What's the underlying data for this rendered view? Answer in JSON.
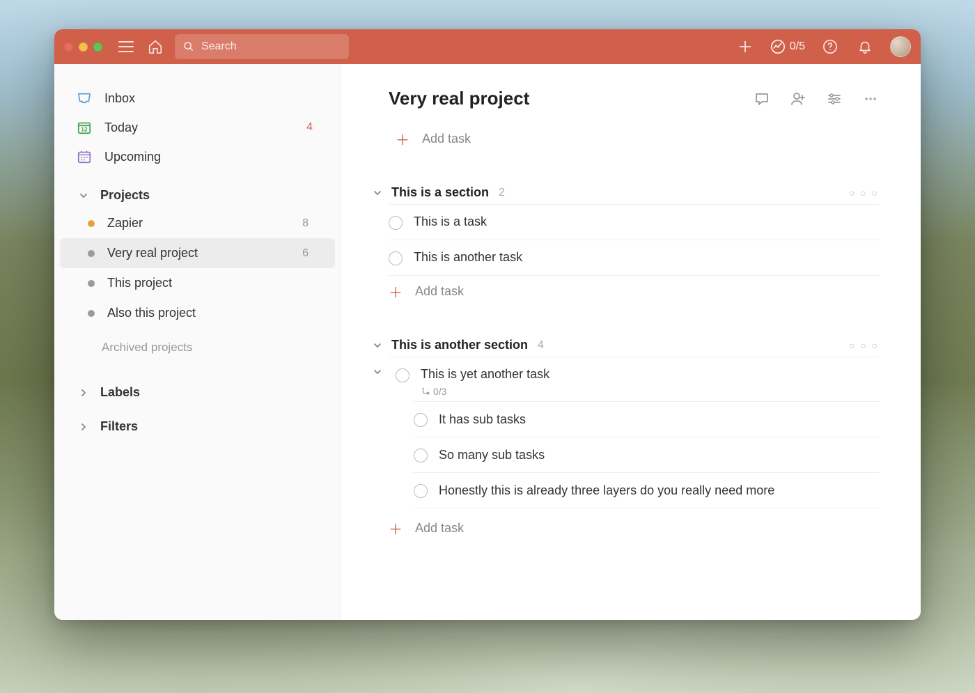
{
  "titlebar": {
    "search_placeholder": "Search",
    "progress_count": "0/5"
  },
  "sidebar": {
    "inbox": "Inbox",
    "today": "Today",
    "today_count": "4",
    "upcoming": "Upcoming",
    "projects_header": "Projects",
    "projects": [
      {
        "name": "Zapier",
        "count": "8",
        "color": "#e8a33d",
        "active": false
      },
      {
        "name": "Very real project",
        "count": "6",
        "color": "#9b9b9b",
        "active": true
      },
      {
        "name": "This project",
        "count": "",
        "color": "#9b9b9b",
        "active": false
      },
      {
        "name": "Also this project",
        "count": "",
        "color": "#9b9b9b",
        "active": false
      }
    ],
    "archived": "Archived projects",
    "labels": "Labels",
    "filters": "Filters"
  },
  "main": {
    "title": "Very real project",
    "add_task": "Add task",
    "sections": [
      {
        "title": "This is a section",
        "count": "2",
        "tasks": [
          {
            "label": "This is a task"
          },
          {
            "label": "This is another task"
          }
        ]
      },
      {
        "title": "This is another section",
        "count": "4",
        "tasks": [
          {
            "label": "This is yet another task",
            "subtask_progress": "0/3",
            "expanded": true,
            "subtasks": [
              {
                "label": "It has sub tasks"
              },
              {
                "label": "So many sub tasks"
              },
              {
                "label": "Honestly this is already three layers do you really need more"
              }
            ]
          }
        ]
      }
    ]
  }
}
